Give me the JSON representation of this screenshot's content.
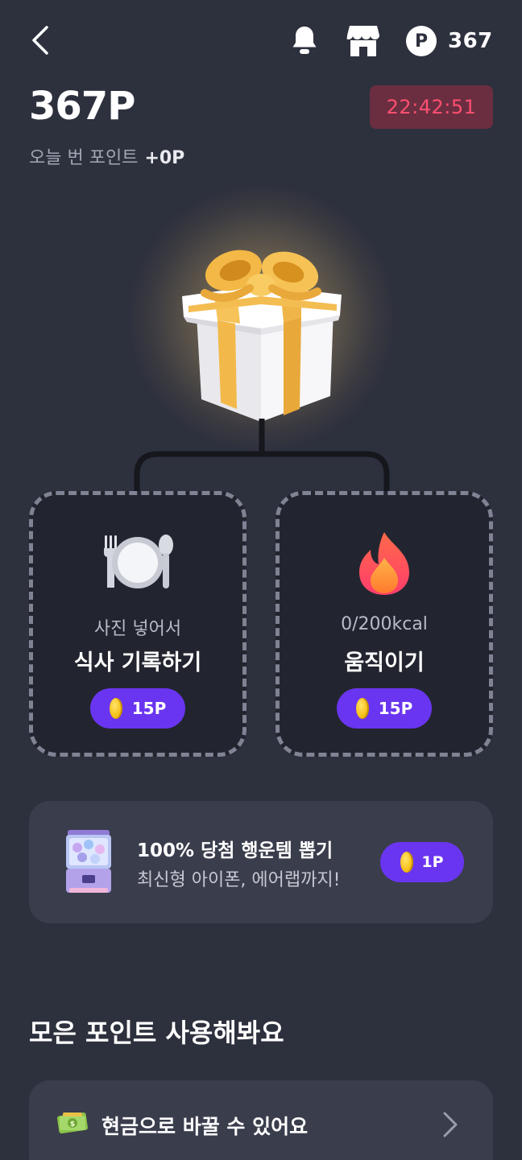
{
  "header": {
    "back_icon": "chevron-left-icon",
    "notifications_icon": "bell-icon",
    "store_icon": "store-icon",
    "points_badge_letter": "P",
    "points_balance": "367"
  },
  "summary": {
    "total_points": "367P",
    "timer": "22:42:51",
    "today_label": "오늘 번 포인트",
    "today_value": "+0P"
  },
  "reward_box": {
    "icon": "gift-box-icon"
  },
  "tasks": [
    {
      "icon": "plate-cutlery-icon",
      "subtitle": "사진 넣어서",
      "title": "식사 기록하기",
      "reward": "15P"
    },
    {
      "icon": "fire-icon",
      "subtitle": "0/200kcal",
      "title": "움직이기",
      "reward": "15P"
    }
  ],
  "lucky": {
    "icon": "gacha-machine-icon",
    "title": "100% 당첨 행운템 뽑기",
    "subtitle": "최신형 아이폰, 에어랩까지!",
    "reward": "1P"
  },
  "use_points": {
    "section_title": "모은 포인트 사용해봐요",
    "cash_icon": "money-bill-icon",
    "cash_label": "현금으로 바꿀 수 있어요",
    "chevron_icon": "chevron-right-icon"
  },
  "colors": {
    "background": "#2d303d",
    "card": "#22252f",
    "panel": "#3a3d4c",
    "accent_purple": "#6a35f0",
    "timer_bg": "#6b2e41",
    "timer_text": "#ff4f70",
    "coin": "#f8c21b"
  }
}
